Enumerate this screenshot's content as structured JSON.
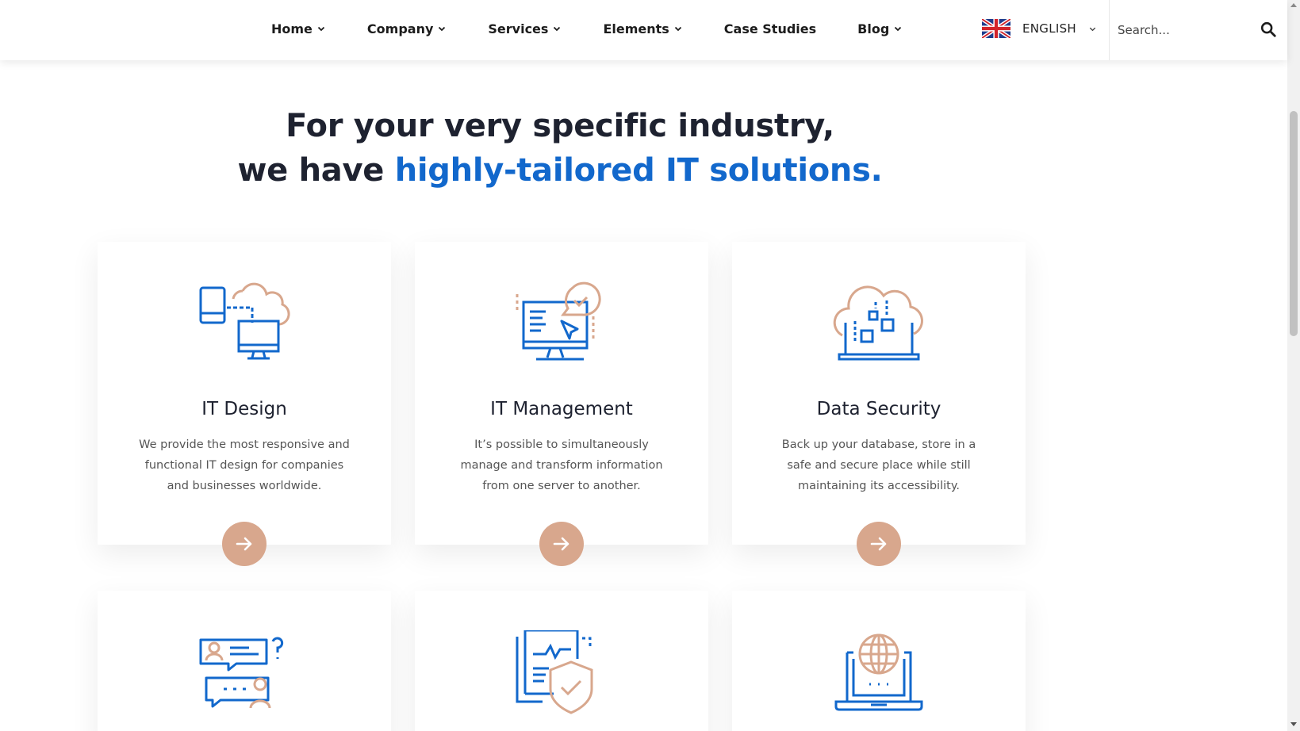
{
  "nav": {
    "items": [
      {
        "label": "Home",
        "has_dropdown": true
      },
      {
        "label": "Company",
        "has_dropdown": true
      },
      {
        "label": "Services",
        "has_dropdown": true
      },
      {
        "label": "Elements",
        "has_dropdown": true
      },
      {
        "label": "Case Studies",
        "has_dropdown": false
      },
      {
        "label": "Blog",
        "has_dropdown": true
      }
    ],
    "language": "ENGLISH",
    "search_placeholder": "Search..."
  },
  "heading": {
    "line1": "For your very specific industry,",
    "line2_prefix": "we have ",
    "line2_accent": "highly-tailored IT solutions."
  },
  "cards": [
    {
      "title": "IT Design",
      "description": "We provide the most responsive and functional IT design for companies and businesses worldwide.",
      "icon": "devices-cloud-icon"
    },
    {
      "title": "IT Management",
      "description": "It’s possible to simultaneously manage and transform information from one server to another.",
      "icon": "monitor-chat-cursor-icon"
    },
    {
      "title": "Data Security",
      "description": "Back up your database, store in a safe and secure place while still maintaining its accessibility.",
      "icon": "cloud-laptop-data-icon"
    },
    {
      "title": "",
      "description": "",
      "icon": "chat-support-icon"
    },
    {
      "title": "",
      "description": "",
      "icon": "document-shield-icon"
    },
    {
      "title": "",
      "description": "",
      "icon": "laptop-globe-icon"
    }
  ],
  "colors": {
    "accent_blue": "#1268cc",
    "accent_peach": "#d8a78d",
    "heading_dark": "#1e2230"
  }
}
